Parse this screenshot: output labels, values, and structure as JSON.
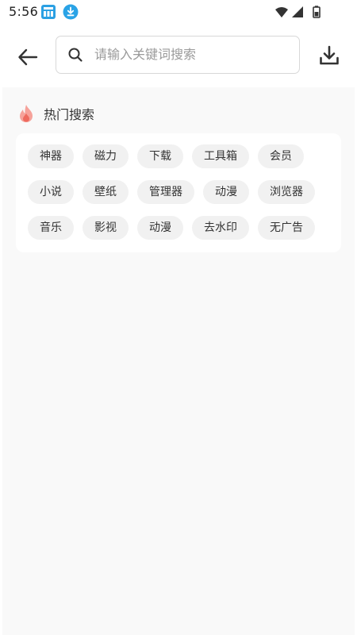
{
  "status_bar": {
    "time": "5:56",
    "left_icons": [
      "app-notification-icon",
      "download-notification-icon"
    ],
    "right_icons": [
      "wifi-icon",
      "signal-icon",
      "battery-icon"
    ]
  },
  "header": {
    "back_icon": "arrow-left-icon",
    "search": {
      "placeholder": "请输入关键词搜索",
      "value": "",
      "icon": "search-icon"
    },
    "download_icon": "download-icon"
  },
  "hot_search": {
    "title": "热门搜索",
    "icon": "fire-icon",
    "rows": [
      [
        "神器",
        "磁力",
        "下载",
        "工具箱",
        "会员"
      ],
      [
        "小说",
        "壁纸",
        "管理器",
        "动漫",
        "浏览器"
      ],
      [
        "音乐",
        "影视",
        "动漫",
        "去水印",
        "无广告"
      ]
    ]
  },
  "colors": {
    "background": "#f9f9f9",
    "card": "#ffffff",
    "tag_bg": "#f1f1f1",
    "fire_accent": "#f28b82",
    "download_badge": "#2aa3e6"
  }
}
